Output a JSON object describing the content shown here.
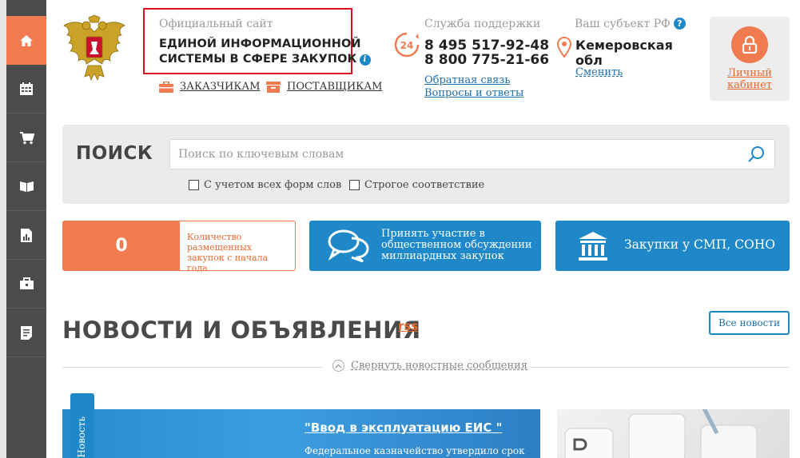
{
  "sidebar": {
    "items": [
      {
        "name": "home",
        "icon": "home-icon",
        "active": true
      },
      {
        "name": "calendar",
        "icon": "calendar-icon"
      },
      {
        "name": "cart",
        "icon": "cart-icon"
      },
      {
        "name": "book",
        "icon": "book-icon"
      },
      {
        "name": "reports",
        "icon": "chart-doc-icon"
      },
      {
        "name": "briefcase",
        "icon": "briefcase-icon"
      },
      {
        "name": "documents",
        "icon": "document-list-icon"
      }
    ]
  },
  "header": {
    "official_label": "Официальный сайт",
    "title_line1": "ЕДИНОЙ ИНФОРМАЦИОННОЙ",
    "title_line2": "СИСТЕМЫ В СФЕРЕ ЗАКУПОК",
    "customers_link": "ЗАКАЗЧИКАМ",
    "suppliers_link": "ПОСТАВЩИКАМ",
    "support": {
      "title": "Служба поддержки",
      "phone1": "8 495 517-92-48",
      "phone2": "8 800 775-21-66",
      "feedback_link": "Обратная связь",
      "faq_link": "Вопросы и ответы",
      "badge": "24"
    },
    "region": {
      "title": "Ваш субъект РФ",
      "name": "Кемеровская обл",
      "change_link": "Сменить"
    },
    "cabinet_label": "Личный кабинет"
  },
  "search": {
    "label": "ПОИСК",
    "placeholder": "Поиск по ключевым словам",
    "option1": "С учетом всех форм слов",
    "option2": "Строгое соответствие"
  },
  "tiles": {
    "count_value": "0",
    "count_label": "Количество размещенных закупок с начала года",
    "discussion_label": "Принять участие в общественном обсуждении миллиардных закупок",
    "smp_label": "Закупки у СМП, СОНО"
  },
  "news": {
    "title": "НОВОСТИ И ОБЪЯВЛЕНИЯ",
    "rss": "rss",
    "all_news": "Все новости",
    "collapse": "Свернуть новостные сообщения",
    "tab_label": "Новость",
    "item_title": "\"Ввод в эксплуатацию ЕИС \"",
    "item_text": "Федеральное казначейство утвердило срок"
  },
  "colors": {
    "accent_orange": "#f07b4f",
    "accent_blue": "#1e88c8",
    "sidebar": "#4b4b4b",
    "highlight_border": "#d9101f"
  }
}
